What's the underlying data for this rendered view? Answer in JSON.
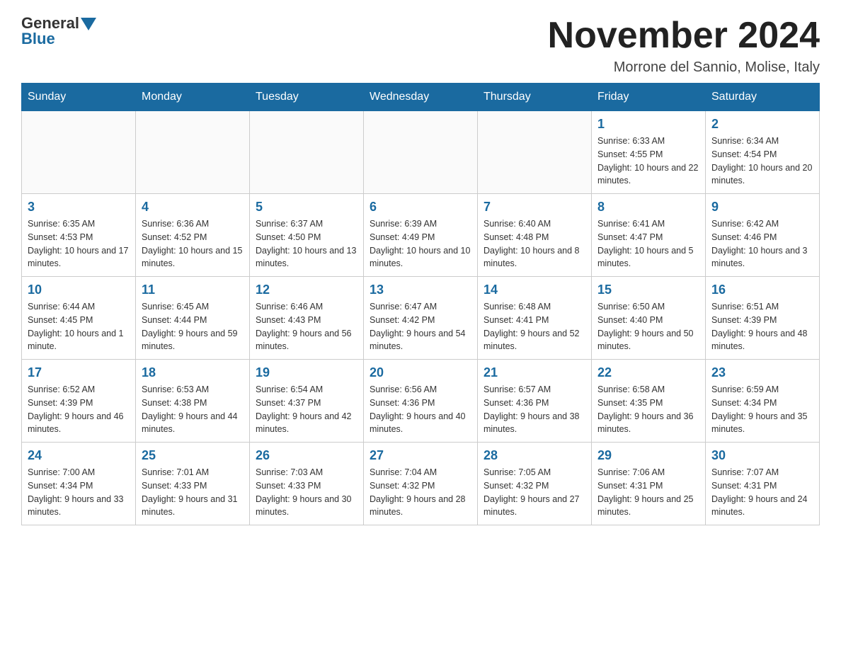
{
  "header": {
    "logo_general": "General",
    "logo_blue": "Blue",
    "month_title": "November 2024",
    "location": "Morrone del Sannio, Molise, Italy"
  },
  "days_of_week": [
    "Sunday",
    "Monday",
    "Tuesday",
    "Wednesday",
    "Thursday",
    "Friday",
    "Saturday"
  ],
  "weeks": [
    [
      {
        "day": "",
        "info": ""
      },
      {
        "day": "",
        "info": ""
      },
      {
        "day": "",
        "info": ""
      },
      {
        "day": "",
        "info": ""
      },
      {
        "day": "",
        "info": ""
      },
      {
        "day": "1",
        "info": "Sunrise: 6:33 AM\nSunset: 4:55 PM\nDaylight: 10 hours and 22 minutes."
      },
      {
        "day": "2",
        "info": "Sunrise: 6:34 AM\nSunset: 4:54 PM\nDaylight: 10 hours and 20 minutes."
      }
    ],
    [
      {
        "day": "3",
        "info": "Sunrise: 6:35 AM\nSunset: 4:53 PM\nDaylight: 10 hours and 17 minutes."
      },
      {
        "day": "4",
        "info": "Sunrise: 6:36 AM\nSunset: 4:52 PM\nDaylight: 10 hours and 15 minutes."
      },
      {
        "day": "5",
        "info": "Sunrise: 6:37 AM\nSunset: 4:50 PM\nDaylight: 10 hours and 13 minutes."
      },
      {
        "day": "6",
        "info": "Sunrise: 6:39 AM\nSunset: 4:49 PM\nDaylight: 10 hours and 10 minutes."
      },
      {
        "day": "7",
        "info": "Sunrise: 6:40 AM\nSunset: 4:48 PM\nDaylight: 10 hours and 8 minutes."
      },
      {
        "day": "8",
        "info": "Sunrise: 6:41 AM\nSunset: 4:47 PM\nDaylight: 10 hours and 5 minutes."
      },
      {
        "day": "9",
        "info": "Sunrise: 6:42 AM\nSunset: 4:46 PM\nDaylight: 10 hours and 3 minutes."
      }
    ],
    [
      {
        "day": "10",
        "info": "Sunrise: 6:44 AM\nSunset: 4:45 PM\nDaylight: 10 hours and 1 minute."
      },
      {
        "day": "11",
        "info": "Sunrise: 6:45 AM\nSunset: 4:44 PM\nDaylight: 9 hours and 59 minutes."
      },
      {
        "day": "12",
        "info": "Sunrise: 6:46 AM\nSunset: 4:43 PM\nDaylight: 9 hours and 56 minutes."
      },
      {
        "day": "13",
        "info": "Sunrise: 6:47 AM\nSunset: 4:42 PM\nDaylight: 9 hours and 54 minutes."
      },
      {
        "day": "14",
        "info": "Sunrise: 6:48 AM\nSunset: 4:41 PM\nDaylight: 9 hours and 52 minutes."
      },
      {
        "day": "15",
        "info": "Sunrise: 6:50 AM\nSunset: 4:40 PM\nDaylight: 9 hours and 50 minutes."
      },
      {
        "day": "16",
        "info": "Sunrise: 6:51 AM\nSunset: 4:39 PM\nDaylight: 9 hours and 48 minutes."
      }
    ],
    [
      {
        "day": "17",
        "info": "Sunrise: 6:52 AM\nSunset: 4:39 PM\nDaylight: 9 hours and 46 minutes."
      },
      {
        "day": "18",
        "info": "Sunrise: 6:53 AM\nSunset: 4:38 PM\nDaylight: 9 hours and 44 minutes."
      },
      {
        "day": "19",
        "info": "Sunrise: 6:54 AM\nSunset: 4:37 PM\nDaylight: 9 hours and 42 minutes."
      },
      {
        "day": "20",
        "info": "Sunrise: 6:56 AM\nSunset: 4:36 PM\nDaylight: 9 hours and 40 minutes."
      },
      {
        "day": "21",
        "info": "Sunrise: 6:57 AM\nSunset: 4:36 PM\nDaylight: 9 hours and 38 minutes."
      },
      {
        "day": "22",
        "info": "Sunrise: 6:58 AM\nSunset: 4:35 PM\nDaylight: 9 hours and 36 minutes."
      },
      {
        "day": "23",
        "info": "Sunrise: 6:59 AM\nSunset: 4:34 PM\nDaylight: 9 hours and 35 minutes."
      }
    ],
    [
      {
        "day": "24",
        "info": "Sunrise: 7:00 AM\nSunset: 4:34 PM\nDaylight: 9 hours and 33 minutes."
      },
      {
        "day": "25",
        "info": "Sunrise: 7:01 AM\nSunset: 4:33 PM\nDaylight: 9 hours and 31 minutes."
      },
      {
        "day": "26",
        "info": "Sunrise: 7:03 AM\nSunset: 4:33 PM\nDaylight: 9 hours and 30 minutes."
      },
      {
        "day": "27",
        "info": "Sunrise: 7:04 AM\nSunset: 4:32 PM\nDaylight: 9 hours and 28 minutes."
      },
      {
        "day": "28",
        "info": "Sunrise: 7:05 AM\nSunset: 4:32 PM\nDaylight: 9 hours and 27 minutes."
      },
      {
        "day": "29",
        "info": "Sunrise: 7:06 AM\nSunset: 4:31 PM\nDaylight: 9 hours and 25 minutes."
      },
      {
        "day": "30",
        "info": "Sunrise: 7:07 AM\nSunset: 4:31 PM\nDaylight: 9 hours and 24 minutes."
      }
    ]
  ]
}
